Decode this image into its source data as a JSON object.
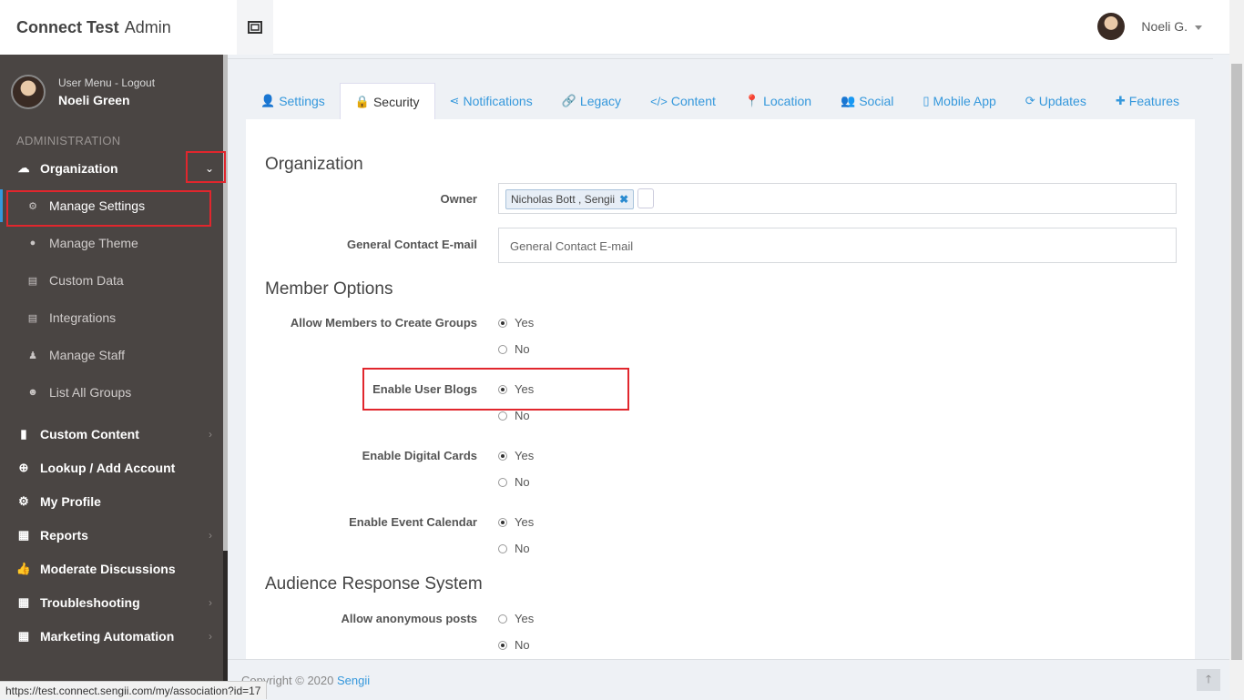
{
  "app": {
    "brand_bold": "Connect Test",
    "brand_light": "Admin"
  },
  "header": {
    "user_short": "Noeli G."
  },
  "sidebar": {
    "user_menu_label": "User Menu - Logout",
    "user_name": "Noeli Green",
    "section_heading": "ADMINISTRATION",
    "organization": "Organization",
    "sub_items": [
      "Manage Settings",
      "Manage Theme",
      "Custom Data",
      "Integrations",
      "Manage Staff",
      "List All Groups"
    ],
    "items": [
      "Custom Content",
      "Lookup / Add Account",
      "My Profile",
      "Reports",
      "Moderate Discussions",
      "Troubleshooting",
      "Marketing Automation"
    ]
  },
  "tabs": [
    "Settings",
    "Security",
    "Notifications",
    "Legacy",
    "Content",
    "Location",
    "Social",
    "Mobile App",
    "Updates",
    "Features"
  ],
  "form": {
    "organization_heading": "Organization",
    "owner_label": "Owner",
    "owner_chip": "Nicholas Bott , Sengii",
    "contact_label": "General Contact E-mail",
    "contact_placeholder": "General Contact E-mail",
    "member_heading": "Member Options",
    "allow_groups_label": "Allow Members to Create Groups",
    "user_blogs_label": "Enable User Blogs",
    "digital_cards_label": "Enable Digital Cards",
    "event_calendar_label": "Enable Event Calendar",
    "audience_heading": "Audience Response System",
    "anonymous_label": "Allow anonymous posts",
    "yes": "Yes",
    "no": "No"
  },
  "footer": {
    "copyright": "Copyright © 2020 ",
    "link": "Sengii"
  },
  "status_url": "https://test.connect.sengii.com/my/association?id=17",
  "colors": {
    "accent": "#3598dc",
    "sidebar": "#4a4543",
    "highlight": "#e1262d"
  }
}
